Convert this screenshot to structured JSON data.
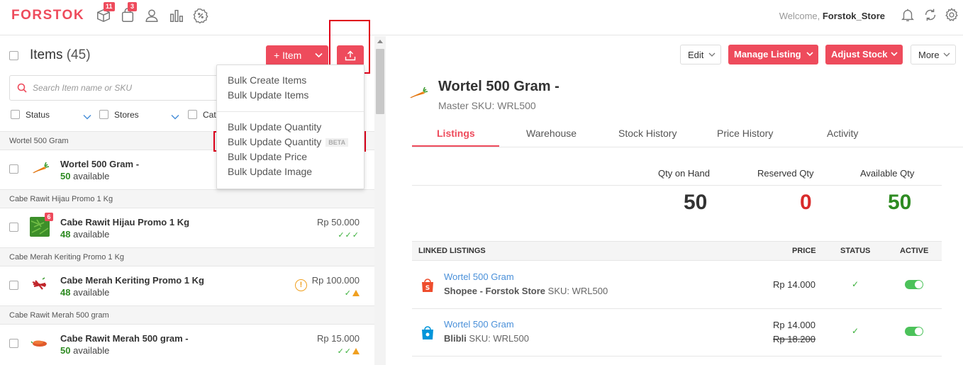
{
  "header": {
    "logo": "FORSTOK",
    "nav": [
      {
        "icon": "box-icon",
        "badge": "11"
      },
      {
        "icon": "shopping-bag-icon",
        "badge": "3"
      },
      {
        "icon": "user-icon",
        "badge": ""
      },
      {
        "icon": "bar-chart-icon",
        "badge": ""
      },
      {
        "icon": "discount-badge-icon",
        "badge": ""
      }
    ],
    "welcome_prefix": "Welcome, ",
    "username": "Forstok_Store",
    "right_icons": [
      "bell-icon",
      "sync-icon",
      "gear-icon"
    ]
  },
  "items_panel": {
    "title": "Items",
    "count": "(45)",
    "add_item_label": "+ Item",
    "search_placeholder": "Search Item name or SKU",
    "filters": [
      "Status",
      "Stores",
      "Cat"
    ],
    "groups": [
      {
        "header": "Wortel 500 Gram",
        "name": "Wortel 500 Gram -",
        "available_qty": "50",
        "available_label": "available",
        "price": "",
        "status": "",
        "badge": ""
      },
      {
        "header": "Cabe Rawit Hijau Promo 1 Kg",
        "name": "Cabe Rawit Hijau Promo 1 Kg",
        "available_qty": "48",
        "available_label": "available",
        "price": "Rp 50.000",
        "status": "✓✓✓",
        "badge": "6"
      },
      {
        "header": "Cabe Merah Keriting Promo 1 Kg",
        "name": "Cabe Merah Keriting Promo 1 Kg",
        "available_qty": "48",
        "available_label": "available",
        "price": "Rp 100.000",
        "status": "✓",
        "badge": ""
      },
      {
        "header": "Cabe Rawit Merah 500 gram",
        "name": "Cabe Rawit Merah 500 gram -",
        "available_qty": "50",
        "available_label": "available",
        "price": "Rp 15.000",
        "status": "✓✓",
        "badge": ""
      }
    ]
  },
  "upload_menu": {
    "items": [
      "Bulk Create Items",
      "Bulk Update Items",
      "Bulk Update Quantity",
      "Bulk Update Quantity",
      "Bulk Update Price",
      "Bulk Update Image"
    ],
    "beta_label": "BETA"
  },
  "detail": {
    "actions": {
      "edit": "Edit",
      "manage_listing": "Manage Listing",
      "adjust_stock": "Adjust Stock",
      "more": "More"
    },
    "title": "Wortel 500 Gram -",
    "master_sku": "Master SKU: WRL500",
    "tabs": [
      "Listings",
      "Warehouse",
      "Stock History",
      "Price History",
      "Activity"
    ],
    "quantities": {
      "on_hand_label": "Qty on Hand",
      "on_hand": "50",
      "reserved_label": "Reserved Qty",
      "reserved": "0",
      "available_label": "Available Qty",
      "available": "50"
    },
    "listings_header": {
      "title": "LINKED LISTINGS",
      "price": "PRICE",
      "status": "STATUS",
      "active": "ACTIVE"
    },
    "listings": [
      {
        "name": "Wortel 500 Gram",
        "store": "Shopee - Forstok Store",
        "sku": "SKU: WRL500",
        "price": "Rp  14.000",
        "old_price": "",
        "status": "✓",
        "active": true,
        "icon": "shopee-icon"
      },
      {
        "name": "Wortel 500 Gram",
        "store": "Blibli",
        "sku": "SKU: WRL500",
        "price": "Rp 14.000",
        "old_price": "Rp  18.200",
        "status": "✓",
        "active": true,
        "icon": "blibli-icon"
      }
    ]
  },
  "colors": {
    "brand": "#ee4b5c",
    "available_green": "#2e8b22",
    "reserved_red": "#d92b2b",
    "link_blue": "#4a90d9",
    "highlight_box": "#e0001b"
  }
}
